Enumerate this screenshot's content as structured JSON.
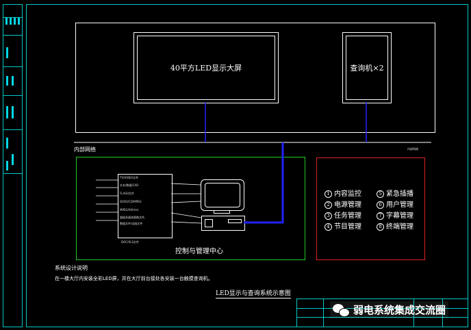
{
  "diagram": {
    "led_screen_label": "40平方LED显示大屏",
    "kiosk_label": "查询机×2",
    "network_left_label": "内部网络",
    "network_right_label": "内部网络",
    "control_center_label": "控制与管理中心",
    "inputs": [
      "TV/VIDEO文件",
      "文本/数据/CAD",
      "FLASH文件",
      "DVD/VCD/MPEG",
      "MPEG/AVI/rm/",
      "超级多媒体图像文件,",
      "数据文件/动画文件"
    ],
    "inputs_bottom": "DOC/XLS文件",
    "functions": [
      {
        "num": "1",
        "label": "内容监控"
      },
      {
        "num": "5",
        "label": "紧急插播"
      },
      {
        "num": "2",
        "label": "电源管理"
      },
      {
        "num": "6",
        "label": "用户管理"
      },
      {
        "num": "3",
        "label": "任务管理"
      },
      {
        "num": "7",
        "label": "字幕管理"
      },
      {
        "num": "4",
        "label": "节目管理"
      },
      {
        "num": "8",
        "label": "终端管理"
      }
    ],
    "design_note_title": "系统设计说明",
    "design_note_text": "在一楼大厅内安装全彩LED屏，并在大厅前台接处各安装一台触摸查询机。",
    "drawing_title": "LED显示与查询系统示意图",
    "watermark": "弱电系统集成交流圈"
  },
  "colors": {
    "frame": "#00c8c8",
    "wire": "#2222ff",
    "control_box": "#22cc22",
    "function_box": "#dd2222",
    "text": "#ffffff"
  }
}
